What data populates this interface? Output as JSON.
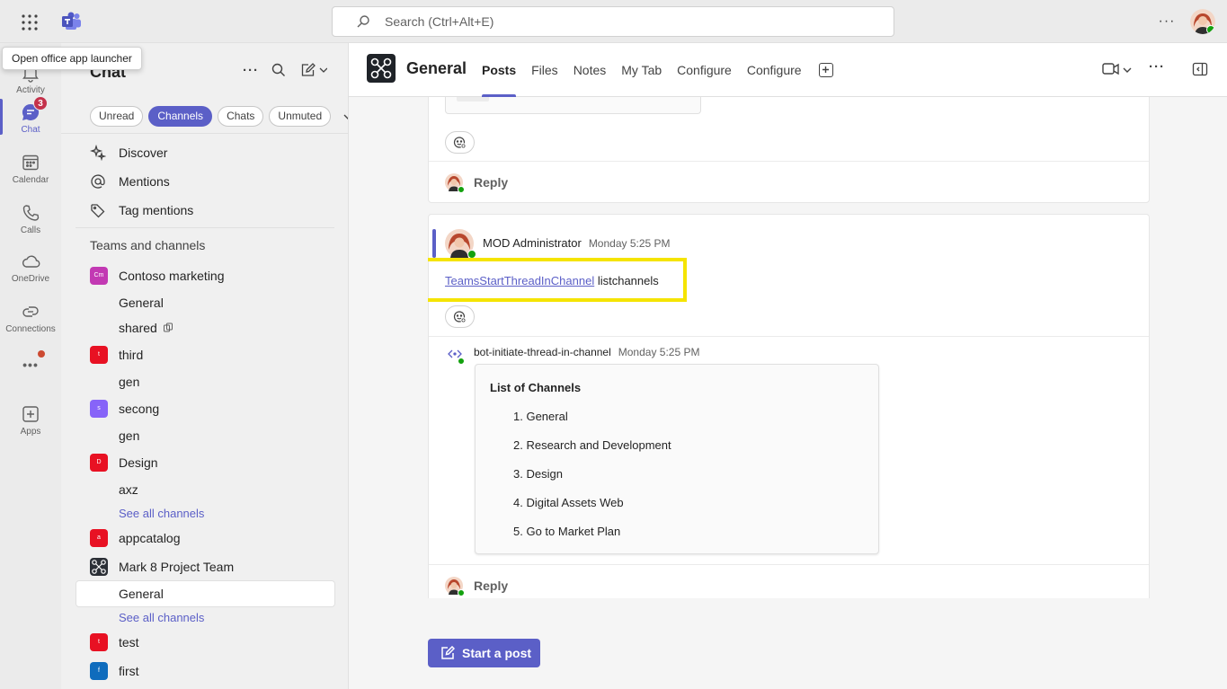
{
  "topbar": {
    "search_placeholder": "Search (Ctrl+Alt+E)",
    "more": "···"
  },
  "tooltip": "Open office app launcher",
  "rail": {
    "items": [
      {
        "label": "Activity",
        "icon": "bell-icon"
      },
      {
        "label": "Chat",
        "icon": "chat-icon",
        "badge": "3"
      },
      {
        "label": "Calendar",
        "icon": "calendar-icon"
      },
      {
        "label": "Calls",
        "icon": "phone-icon"
      },
      {
        "label": "OneDrive",
        "icon": "cloud-icon"
      },
      {
        "label": "Connections",
        "icon": "connections-icon"
      },
      {
        "label": "•••",
        "icon": "more-icon"
      },
      {
        "label": "Apps",
        "icon": "apps-plus-icon"
      }
    ]
  },
  "sidebar": {
    "title": "Chat",
    "filters": [
      "Unread",
      "Channels",
      "Chats",
      "Unmuted"
    ],
    "nav": [
      {
        "label": "Discover",
        "icon": "sparkle-icon"
      },
      {
        "label": "Mentions",
        "icon": "at-icon"
      },
      {
        "label": "Tag mentions",
        "icon": "tag-icon"
      }
    ],
    "section_label": "Teams and channels",
    "teams": [
      {
        "name": "Contoso marketing",
        "abbr": "Cm",
        "color": "#c239b3"
      },
      {
        "name": "third",
        "abbr": "t",
        "color": "#e81123"
      },
      {
        "name": "secong",
        "abbr": "s",
        "color": "#8764f8"
      },
      {
        "name": "Design",
        "abbr": "D",
        "color": "#e81123"
      },
      {
        "name": "appcatalog",
        "abbr": "a",
        "color": "#e81123"
      },
      {
        "name": "Mark 8 Project Team",
        "abbr": "",
        "color": "#2b2f36"
      },
      {
        "name": "test",
        "abbr": "t",
        "color": "#e81123"
      },
      {
        "name": "first",
        "abbr": "f",
        "color": "#0f6cbd"
      }
    ],
    "channels": {
      "contoso_general": "General",
      "contoso_shared": "shared",
      "third_gen": "gen",
      "secong_gen": "gen",
      "design_axz": "axz",
      "see_all_1": "See all channels",
      "mark8_general": "General",
      "see_all_2": "See all channels"
    }
  },
  "header": {
    "channel_title": "General",
    "tabs": [
      "Posts",
      "Files",
      "Notes",
      "My Tab",
      "Configure",
      "Configure"
    ],
    "active_tab": "Posts"
  },
  "feed": {
    "reply_label": "Reply",
    "message": {
      "author": "MOD Administrator",
      "time": "Monday 5:25 PM",
      "link_text": "TeamsStartThreadInChannel",
      "text": "listchannels"
    },
    "bot_reply": {
      "author": "bot-initiate-thread-in-channel",
      "time": "Monday 5:25 PM",
      "card_title": "List of Channels",
      "items": [
        "1. General",
        "2. Research and Development",
        "3. Design",
        "4. Digital Assets Web",
        "5. Go to Market Plan"
      ]
    }
  },
  "compose": {
    "start_post_label": "Start a post"
  },
  "colors": {
    "accent": "#5b5fc7",
    "highlight": "#f5e400",
    "presence": "#13a10e",
    "badge": "#c4314b"
  }
}
